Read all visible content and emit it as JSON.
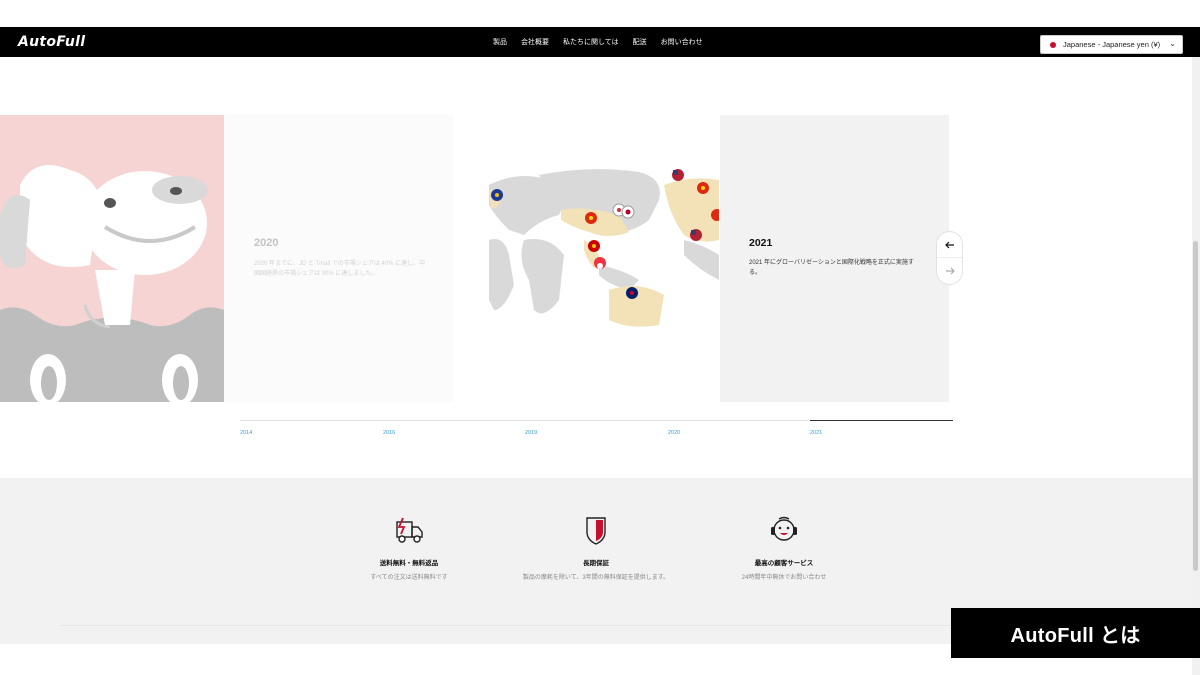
{
  "header": {
    "logo": "AutoFull",
    "nav": [
      "製品",
      "会社概要",
      "私たちに関しては",
      "配送",
      "お問い合わせ"
    ],
    "language_select": "Japanese - Japanese yen (¥)"
  },
  "slides": {
    "previous": {
      "year": "2020",
      "text": "2020 年までに、JD と Tmall での市場シェアは 40% に達し、中国国経界の市場シェアは 30% に達しました。"
    },
    "current": {
      "year": "2021",
      "text": "2021 年にグローバリゼーションと国際化戦略を正式に実施する。"
    }
  },
  "timeline": {
    "years": [
      "2014",
      "2016",
      "2019",
      "2020",
      "2021"
    ],
    "active": "2021"
  },
  "features": [
    {
      "icon": "delivery-truck-icon",
      "title": "送料無料・無料返品",
      "subtitle": "すべての注文は送料無料です"
    },
    {
      "icon": "shield-icon",
      "title": "長期保証",
      "subtitle": "製品の摩耗を除いて、3年間の無料保証を提供します。"
    },
    {
      "icon": "customer-service-icon",
      "title": "最高の顧客サービス",
      "subtitle": "24時間年中無休でお問い合わせ"
    }
  ],
  "banner": "AutoFull とは",
  "colors": {
    "accent": "#c8102e",
    "timeline_year": "#3aa0d8",
    "pink_panel": "#f6d4d4"
  }
}
